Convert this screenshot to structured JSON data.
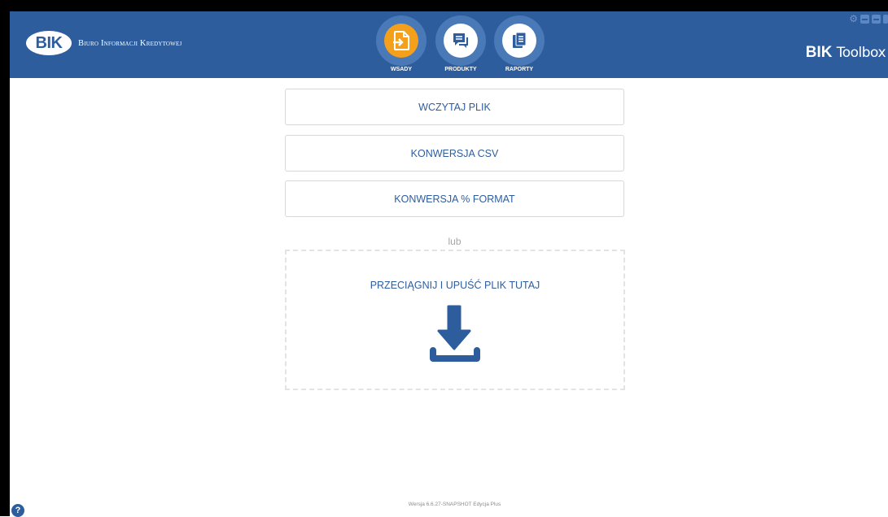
{
  "header": {
    "logo_text": "BIK",
    "company_name": "Biuro Informacji Kredytowej",
    "app_title_bold": "BIK",
    "app_title_rest": "Toolbox"
  },
  "nav": {
    "items": [
      {
        "label": "WSADY",
        "icon": "file-import-icon",
        "active": true
      },
      {
        "label": "PRODUKTY",
        "icon": "chat-bubbles-icon",
        "active": false
      },
      {
        "label": "RAPORTY",
        "icon": "documents-icon",
        "active": false
      }
    ]
  },
  "window_controls": [
    "gear-icon",
    "minimize-icon",
    "maximize-icon",
    "close-icon"
  ],
  "main": {
    "buttons": [
      {
        "label": "WCZYTAJ PLIK"
      },
      {
        "label": "KONWERSJA CSV"
      },
      {
        "label": "KONWERSJA % FORMAT"
      }
    ],
    "separator": "lub",
    "dropzone": {
      "label": "PRZECIĄGNIJ I UPUŚĆ PLIK TUTAJ",
      "icon": "download-icon"
    }
  },
  "footer": {
    "version": "Wersja 6.6.27-SNAPSHOT Edycja Plus",
    "help_icon": "help-icon"
  },
  "colors": {
    "brand_blue": "#2e5d9e",
    "active_orange": "#f5a01a",
    "border_gray": "#d8d8d8"
  }
}
